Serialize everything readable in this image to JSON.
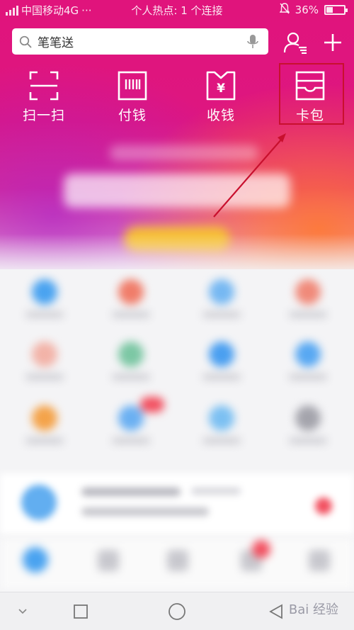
{
  "status_bar": {
    "carrier": "中国移动4G",
    "dots": "···",
    "hotspot": "个人热点: 1 个连接",
    "battery": "36%",
    "battery_level": 0.36
  },
  "search": {
    "value": "笔笔送",
    "icons": [
      "search-icon",
      "mic-icon"
    ]
  },
  "header_buttons": [
    "contacts-icon",
    "plus-icon"
  ],
  "actions": [
    {
      "label": "扫一扫",
      "icon": "scan-icon"
    },
    {
      "label": "付钱",
      "icon": "barcode-icon"
    },
    {
      "label": "收钱",
      "icon": "yuan-receive-icon"
    },
    {
      "label": "卡包",
      "icon": "card-wallet-icon"
    }
  ],
  "annotation": {
    "color": "#c8102e",
    "target": "卡包"
  },
  "watermark": "Bai 经验",
  "colors": {
    "brand_magenta": "#e0147c",
    "accent_orange": "#ff7828"
  }
}
